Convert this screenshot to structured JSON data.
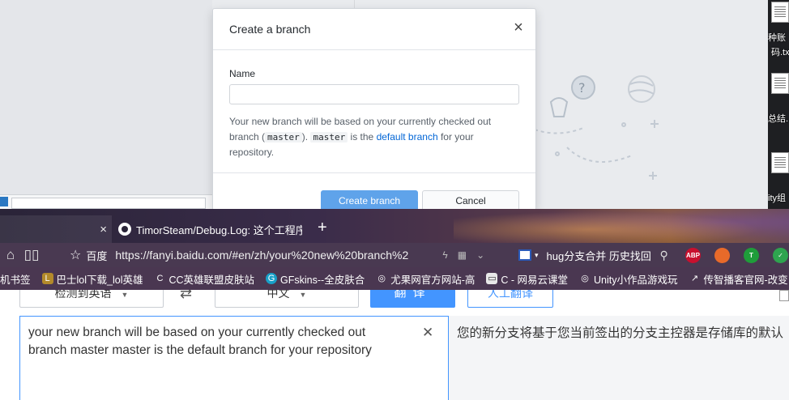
{
  "dialog": {
    "title": "Create a branch",
    "name_label": "Name",
    "name_value": "",
    "hint_part1": "Your new branch will be based on your currently checked out branch (",
    "hint_code1": "master",
    "hint_part2": "). ",
    "hint_code2": "master",
    "hint_part3": " is the ",
    "hint_link": "default branch",
    "hint_part4": " for your repository.",
    "create_label": "Create branch",
    "cancel_label": "Cancel"
  },
  "desktop": {
    "labels": [
      "种账",
      "码.tx",
      "总结.",
      "ity组"
    ]
  },
  "browser": {
    "tabs": [
      {
        "title": ""
      },
      {
        "title": "TimorSteam/Debug.Log: 这个工程序"
      }
    ],
    "site_tag": "百度",
    "url": "https://fanyi.baidu.com/#en/zh/your%20new%20branch%2",
    "search_query": "hug分支合并 历史找回",
    "extensions": [
      {
        "name": "abp-icon",
        "label": "ABP",
        "color": "#c8102e"
      },
      {
        "name": "game-icon",
        "label": "",
        "color": "#e86a2a"
      },
      {
        "name": "t-icon",
        "label": "T",
        "color": "#1f9d3a"
      },
      {
        "name": "shield-check-icon",
        "label": "✓",
        "color": "#2ea44f"
      }
    ],
    "bookmarks": [
      {
        "label": "机书签",
        "icon": "",
        "color": "transparent"
      },
      {
        "label": "巴士lol下载_lol英雄",
        "icon": "L",
        "color": "#b38a2a"
      },
      {
        "label": "CC英雄联盟皮肤站",
        "icon": "C",
        "color": "transparent"
      },
      {
        "label": "GFskins--全皮肤合",
        "icon": "G",
        "color": "#18a0c8"
      },
      {
        "label": "尤果网官方网站-高",
        "icon": "◎",
        "color": "transparent"
      },
      {
        "label": "C - 网易云课堂",
        "icon": "▭",
        "color": "#e8e8e8"
      },
      {
        "label": "Unity小作品游戏玩",
        "icon": "◎",
        "color": "transparent"
      },
      {
        "label": "传智播客官网-改变",
        "icon": "↗",
        "color": "transparent"
      }
    ]
  },
  "translate": {
    "src_lang": "检测到英语",
    "tgt_lang": "中文",
    "translate_btn": "翻译",
    "human_btn": "人工翻译",
    "source_text": "your new branch will be based on your currently checked out branch master master is the default branch for your  repository",
    "result_text": "您的新分支将基于您当前签出的分支主控器是存储库的默认"
  }
}
